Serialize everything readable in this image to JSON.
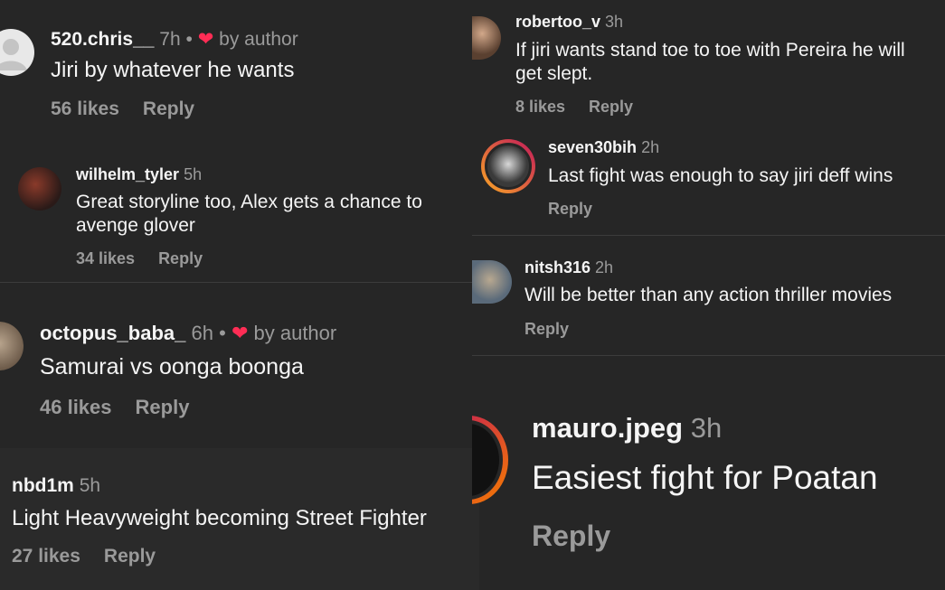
{
  "left": [
    {
      "user": "520.chris__",
      "time": "7h",
      "by_author": "by author",
      "text": "Jiri by whatever he wants",
      "likes": "56 likes",
      "reply": "Reply"
    },
    {
      "user": "wilhelm_tyler",
      "time": "5h",
      "text1": "Great storyline too, Alex gets a chance to",
      "text2": "avenge glover",
      "likes": "34 likes",
      "reply": "Reply"
    },
    {
      "user": "octopus_baba_",
      "time": "6h",
      "by_author": "by author",
      "text": "Samurai vs oonga boonga",
      "likes": "46 likes",
      "reply": "Reply"
    },
    {
      "user": "nbd1m",
      "time": "5h",
      "text": "Light Heavyweight becoming Street Fighter",
      "likes": "27 likes",
      "reply": "Reply"
    }
  ],
  "right": [
    {
      "user": "robertoo_v",
      "time": "3h",
      "text1": "If jiri wants stand toe to toe with Pereira he will",
      "text2": "get slept.",
      "likes": "8 likes",
      "reply": "Reply"
    },
    {
      "user": "seven30bih",
      "time": "2h",
      "text": "Last fight was enough to say jiri deff wins",
      "reply": "Reply"
    },
    {
      "user": "nitsh316",
      "time": "2h",
      "text": "Will be better than any action thriller movies",
      "reply": "Reply"
    },
    {
      "user": "mauro.jpeg",
      "time": "3h",
      "text": "Easiest fight for Poatan",
      "reply": "Reply"
    }
  ],
  "icons": {
    "dot": "•",
    "heart": "❤"
  },
  "colors": {
    "background": "#262626",
    "muted": "#9a9a9a",
    "heart": "#ff2d55",
    "story_ring_start": "#f9a825",
    "story_ring_end": "#c2185b"
  }
}
